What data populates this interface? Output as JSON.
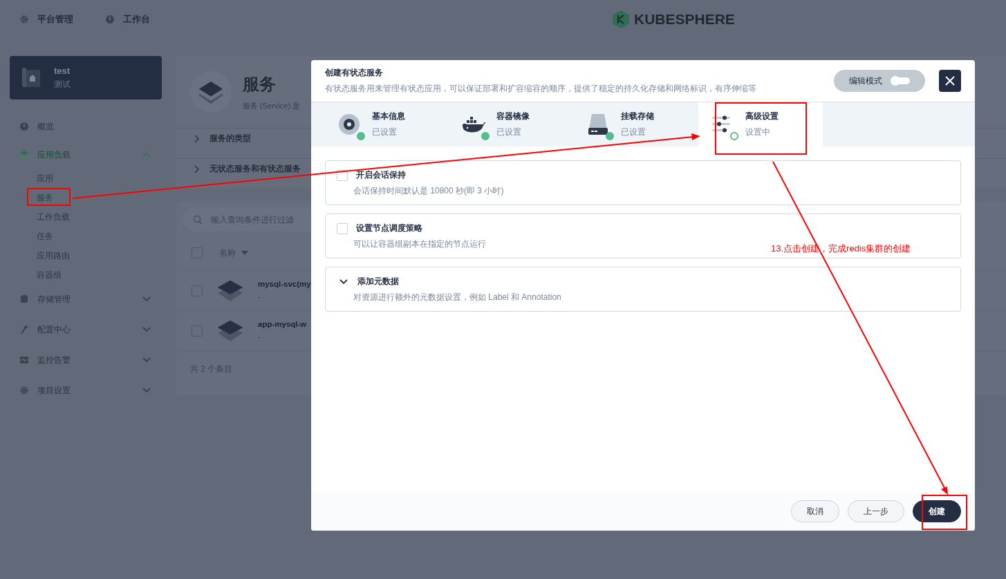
{
  "top_nav": [
    {
      "label": "平台管理"
    },
    {
      "label": "工作台"
    }
  ],
  "logo": {
    "text": "KUBESPHERE"
  },
  "project": {
    "name": "test",
    "alias": "测试"
  },
  "sidebar": {
    "items": [
      {
        "label": "概览"
      },
      {
        "label": "应用负载",
        "expanded": true,
        "children": [
          {
            "label": "应用",
            "selected": false,
            "highlighted": false
          },
          {
            "label": "服务",
            "selected": true,
            "highlighted": true
          },
          {
            "label": "工作负载",
            "selected": false,
            "highlighted": false
          },
          {
            "label": "任务",
            "selected": false,
            "highlighted": false
          },
          {
            "label": "应用路由",
            "selected": false,
            "highlighted": false
          },
          {
            "label": "容器组",
            "selected": false,
            "highlighted": false
          }
        ]
      },
      {
        "label": "存储管理",
        "expanded": false
      },
      {
        "label": "配置中心",
        "expanded": false
      },
      {
        "label": "监控告警",
        "expanded": false
      },
      {
        "label": "项目设置",
        "expanded": false
      }
    ]
  },
  "page": {
    "title": "服务",
    "description": "服务 (Service) 是",
    "sections": [
      {
        "label": "服务的类型"
      },
      {
        "label": "无状态服务和有状态服务"
      }
    ]
  },
  "table": {
    "search": {
      "placeholder": "输入查询条件进行过滤"
    },
    "all_checked": false,
    "columns": [
      {
        "label": "名称"
      }
    ],
    "rows": [
      {
        "name": "mysql-svc(my",
        "detail": "-",
        "checked": false
      },
      {
        "name": "app-mysql-w",
        "detail": "-",
        "checked": false
      }
    ],
    "footer": "共 2 个条目"
  },
  "dialog": {
    "title": "创建有状态服务",
    "description": "有状态服务用来管理有状态应用，可以保证部署和扩容缩容的顺序，提供了稳定的持久化存储和网络标识，有序伸缩等",
    "edit_mode": {
      "label": "编辑模式",
      "on": false
    },
    "steps": [
      {
        "title": "基本信息",
        "status": "已设置",
        "done": true,
        "selected": false,
        "highlighted": false
      },
      {
        "title": "容器镜像",
        "status": "已设置",
        "done": true,
        "selected": false,
        "highlighted": false
      },
      {
        "title": "挂载存储",
        "status": "已设置",
        "done": true,
        "selected": false,
        "highlighted": false
      },
      {
        "title": "高级设置",
        "status": "设置中",
        "done": false,
        "selected": true,
        "highlighted": true
      }
    ],
    "options": [
      {
        "kind": "checkbox",
        "title": "开启会话保持",
        "description": "会话保持时间默认是 10800 秒(即 3 小时)",
        "checked": false
      },
      {
        "kind": "checkbox",
        "title": "设置节点调度策略",
        "description": "可以让容器组副本在指定的节点运行",
        "checked": false
      },
      {
        "kind": "expand",
        "title": "添加元数据",
        "description": "对资源进行额外的元数据设置，例如 Label 和 Annotation",
        "expanded": false
      }
    ],
    "buttons": [
      {
        "label": "取消",
        "kind": "secondary",
        "highlighted": false
      },
      {
        "label": "上一步",
        "kind": "secondary",
        "highlighted": false
      },
      {
        "label": "创建",
        "kind": "primary",
        "highlighted": true
      }
    ]
  },
  "annotation": {
    "text": "13.点击创建，完成redis集群的创建"
  }
}
